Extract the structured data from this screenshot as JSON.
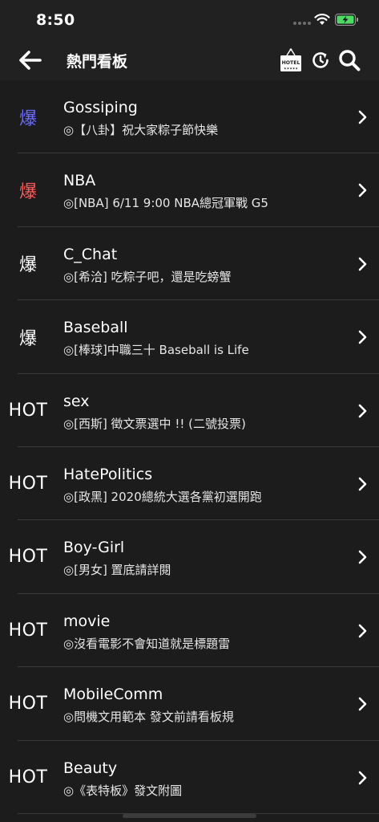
{
  "status_bar": {
    "time": "8:50"
  },
  "nav": {
    "title": "熱門看板",
    "back_icon": "arrow-left-icon",
    "hotel_icon": "hotel-sign-icon",
    "hotel_label": "HOTEL",
    "history_icon": "history-icon",
    "search_icon": "search-icon"
  },
  "colors": {
    "background": "#1c1c1c",
    "bar": "#212121",
    "badge_blue": "#6b6bff",
    "badge_red": "#ff5a5a",
    "battery_fill": "#4cd964",
    "divider": "#3a3a3a"
  },
  "boards": [
    {
      "badge": "爆",
      "badge_color": "#6b6bff",
      "name": "Gossiping",
      "desc": "◎【八卦】祝大家粽子節快樂"
    },
    {
      "badge": "爆",
      "badge_color": "#ff5a5a",
      "name": "NBA",
      "desc": "◎[NBA] 6/11 9:00 NBA總冠軍戰 G5"
    },
    {
      "badge": "爆",
      "badge_color": "#ffffff",
      "name": "C_Chat",
      "desc": "◎[希洽] 吃粽子吧，還是吃螃蟹"
    },
    {
      "badge": "爆",
      "badge_color": "#ffffff",
      "name": "Baseball",
      "desc": "◎[棒球]中職三十 Baseball is Life"
    },
    {
      "badge": "HOT",
      "badge_color": "#ffffff",
      "name": "sex",
      "desc": "◎[西斯] 徵文票選中 !! (二號投票)"
    },
    {
      "badge": "HOT",
      "badge_color": "#ffffff",
      "name": "HatePolitics",
      "desc": "◎[政黑] 2020總統大選各黨初選開跑"
    },
    {
      "badge": "HOT",
      "badge_color": "#ffffff",
      "name": "Boy-Girl",
      "desc": "◎[男女] 置底請詳閱"
    },
    {
      "badge": "HOT",
      "badge_color": "#ffffff",
      "name": "movie",
      "desc": "◎沒看電影不會知道就是標題雷"
    },
    {
      "badge": "HOT",
      "badge_color": "#ffffff",
      "name": "MobileComm",
      "desc": "◎問機文用範本 發文前請看板規"
    },
    {
      "badge": "HOT",
      "badge_color": "#ffffff",
      "name": "Beauty",
      "desc": "◎《表特板》發文附圖"
    }
  ]
}
